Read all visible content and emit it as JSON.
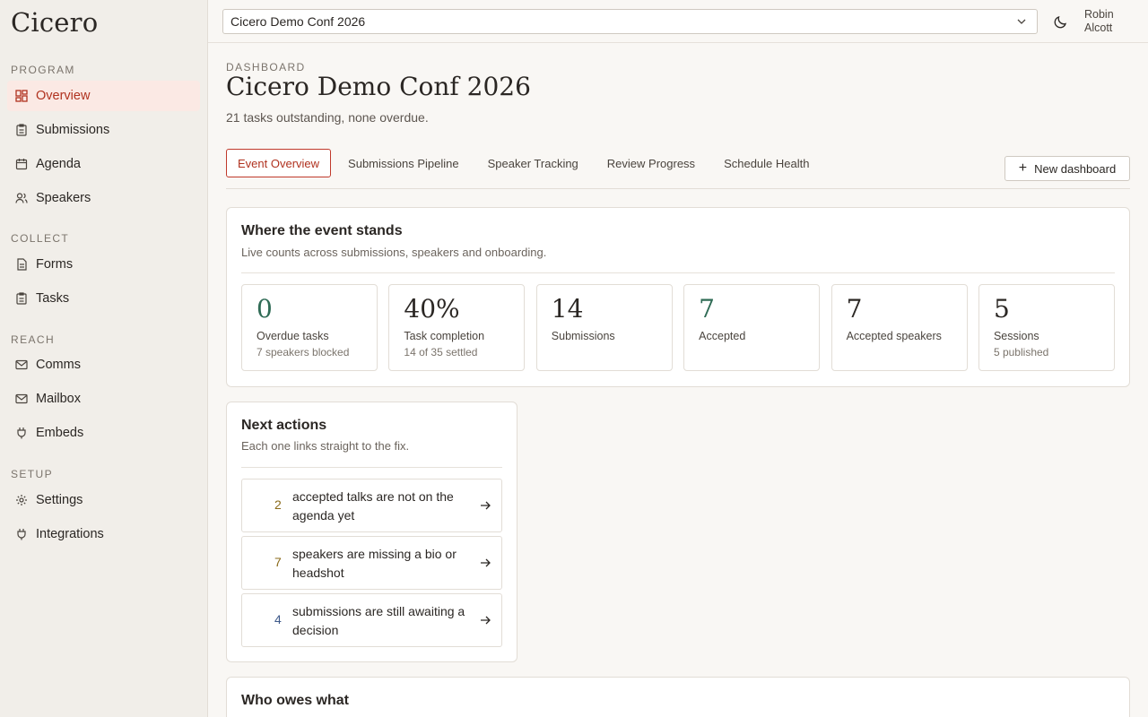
{
  "sidebar": {
    "brand": "Cicero",
    "sections": [
      {
        "label": "PROGRAM",
        "items": [
          {
            "label": "Overview",
            "icon": "grid-icon",
            "active": true
          },
          {
            "label": "Submissions",
            "icon": "clipboard-icon"
          },
          {
            "label": "Agenda",
            "icon": "calendar-icon"
          },
          {
            "label": "Speakers",
            "icon": "users-icon"
          }
        ]
      },
      {
        "label": "COLLECT",
        "items": [
          {
            "label": "Forms",
            "icon": "document-icon"
          },
          {
            "label": "Tasks",
            "icon": "clipboard-check-icon"
          }
        ]
      },
      {
        "label": "REACH",
        "items": [
          {
            "label": "Comms",
            "icon": "mail-icon"
          },
          {
            "label": "Mailbox",
            "icon": "mail-icon"
          },
          {
            "label": "Embeds",
            "icon": "plug-icon"
          }
        ]
      },
      {
        "label": "SETUP",
        "items": [
          {
            "label": "Settings",
            "icon": "gear-icon"
          },
          {
            "label": "Integrations",
            "icon": "plug-icon"
          }
        ]
      }
    ]
  },
  "topbar": {
    "event_select_value": "Cicero Demo Conf 2026",
    "user_first": "Robin",
    "user_last": "Alcott"
  },
  "header": {
    "eyebrow": "DASHBOARD",
    "title": "Cicero Demo Conf 2026",
    "subtitle": "21 tasks outstanding, none overdue."
  },
  "tabs": [
    {
      "label": "Event Overview",
      "active": true
    },
    {
      "label": "Submissions Pipeline"
    },
    {
      "label": "Speaker Tracking"
    },
    {
      "label": "Review Progress"
    },
    {
      "label": "Schedule Health"
    }
  ],
  "new_dashboard_label": "New dashboard",
  "event_card": {
    "title": "Where the event stands",
    "subtitle": "Live counts across submissions, speakers and onboarding.",
    "stats": [
      {
        "value": "0",
        "label": "Overdue tasks",
        "sub": "7 speakers blocked",
        "accent": "#2f6b55"
      },
      {
        "value": "40%",
        "label": "Task completion",
        "sub": "14 of 35 settled"
      },
      {
        "value": "14",
        "label": "Submissions",
        "sub": ""
      },
      {
        "value": "7",
        "label": "Accepted",
        "sub": "",
        "accent": "#2f6b55"
      },
      {
        "value": "7",
        "label": "Accepted speakers",
        "sub": ""
      },
      {
        "value": "5",
        "label": "Sessions",
        "sub": "5 published"
      }
    ]
  },
  "actions_card": {
    "title": "Next actions",
    "subtitle": "Each one links straight to the fix.",
    "items": [
      {
        "count": "2",
        "text": "accepted talks are not on the agenda yet"
      },
      {
        "count": "7",
        "text": "speakers are missing a bio or headshot"
      },
      {
        "count": "4",
        "text": "submissions are still awaiting a decision"
      }
    ]
  },
  "owes_card": {
    "title": "Who owes what"
  },
  "colors": {
    "accent": "#b0321f",
    "active_bg": "#fbe9e4",
    "green": "#2f6b55"
  }
}
